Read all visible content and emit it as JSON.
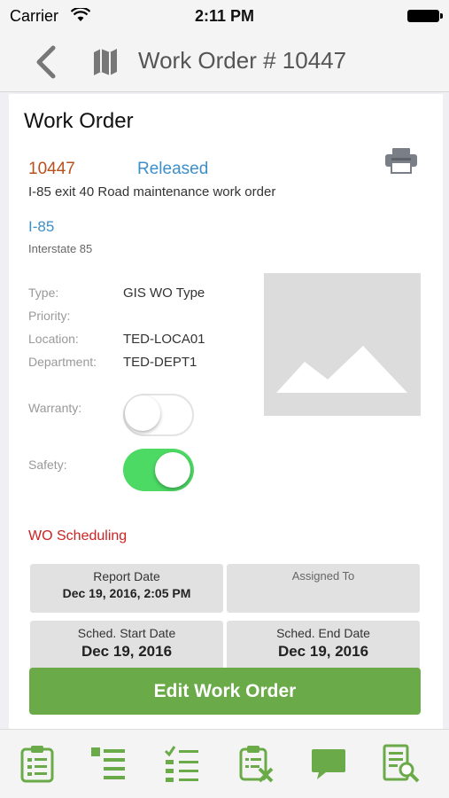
{
  "status_bar": {
    "carrier": "Carrier",
    "time": "2:11 PM"
  },
  "nav": {
    "title": "Work Order # 10447",
    "back_icon": "chevron-left-icon",
    "map_icon": "map-icon"
  },
  "card": {
    "title": "Work Order",
    "wo_number": "10447",
    "status": "Released",
    "description": "I-85 exit 40 Road maintenance work order",
    "asset_id": "I-85",
    "asset_description": "Interstate 85",
    "fields": {
      "type_label": "Type:",
      "type_value": "GIS WO Type",
      "priority_label": "Priority:",
      "priority_value": "",
      "location_label": "Location:",
      "location_value": "TED-LOCA01",
      "department_label": "Department:",
      "department_value": "TED-DEPT1"
    },
    "warranty": {
      "label": "Warranty:",
      "on": false
    },
    "safety": {
      "label": "Safety:",
      "on": true
    },
    "scheduling": {
      "title": "WO Scheduling",
      "report_date_label": "Report Date",
      "report_date_value": "Dec 19, 2016, 2:05 PM",
      "assigned_to_label": "Assigned To",
      "assigned_to_value": "",
      "sched_start_label": "Sched. Start Date",
      "sched_start_value": "Dec 19, 2016",
      "sched_end_label": "Sched. End Date",
      "sched_end_value": "Dec 19, 2016"
    }
  },
  "actions": {
    "edit_label": "Edit Work Order"
  },
  "tabs": [
    "clipboard-icon",
    "list-icon",
    "checklist-icon",
    "clipboard-cancel-icon",
    "chat-icon",
    "document-search-icon"
  ],
  "colors": {
    "accent_green": "#6aaa48",
    "status_blue": "#3d8fc8",
    "wo_number_orange": "#b8501b",
    "section_red": "#cc2222",
    "toggle_on": "#4cd964"
  }
}
